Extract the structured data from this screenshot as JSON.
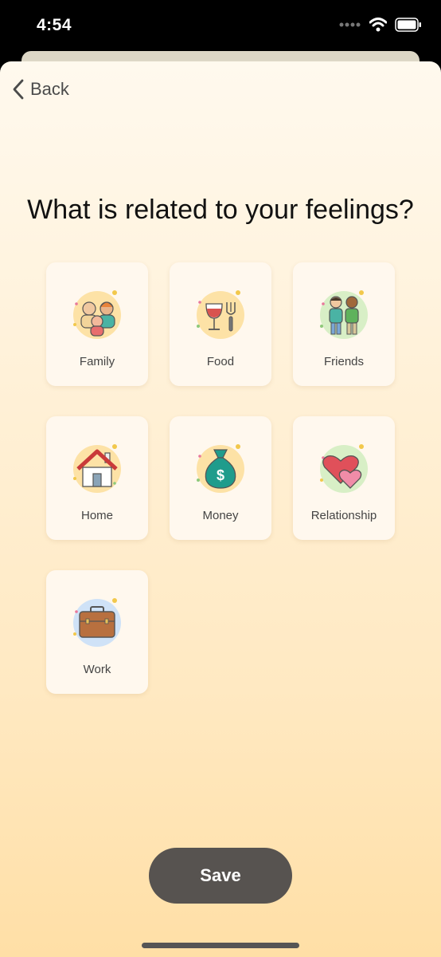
{
  "status_bar": {
    "time": "4:54"
  },
  "header": {
    "back_label": "Back"
  },
  "title": "What is related to your feelings?",
  "categories": [
    {
      "label": "Family",
      "icon": "family-icon"
    },
    {
      "label": "Food",
      "icon": "food-icon"
    },
    {
      "label": "Friends",
      "icon": "friends-icon"
    },
    {
      "label": "Home",
      "icon": "home-icon"
    },
    {
      "label": "Money",
      "icon": "money-icon"
    },
    {
      "label": "Relationship",
      "icon": "relationship-icon"
    },
    {
      "label": "Work",
      "icon": "work-icon"
    }
  ],
  "save_label": "Save",
  "colors": {
    "save_button": "#575350",
    "gradient_top": "#fff9ee",
    "gradient_bottom": "#ffdfa6"
  }
}
